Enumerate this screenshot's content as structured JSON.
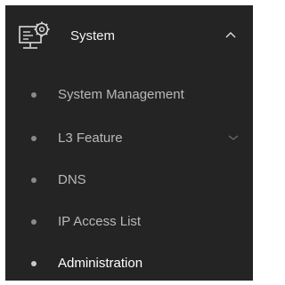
{
  "nav": {
    "group": {
      "title": "System",
      "icon": "system-settings-icon",
      "expanded": true
    },
    "items": [
      {
        "label": "System Management",
        "has_submenu": false,
        "active": false
      },
      {
        "label": "L3 Feature",
        "has_submenu": true,
        "active": false
      },
      {
        "label": "DNS",
        "has_submenu": false,
        "active": false
      },
      {
        "label": "IP Access List",
        "has_submenu": false,
        "active": false
      },
      {
        "label": "Administration",
        "has_submenu": false,
        "active": true
      }
    ]
  },
  "colors": {
    "panel_background": "#242424",
    "text_primary": "#f2f2f2",
    "text_secondary": "#b9b9b9",
    "bullet": "#8a8a8a"
  }
}
